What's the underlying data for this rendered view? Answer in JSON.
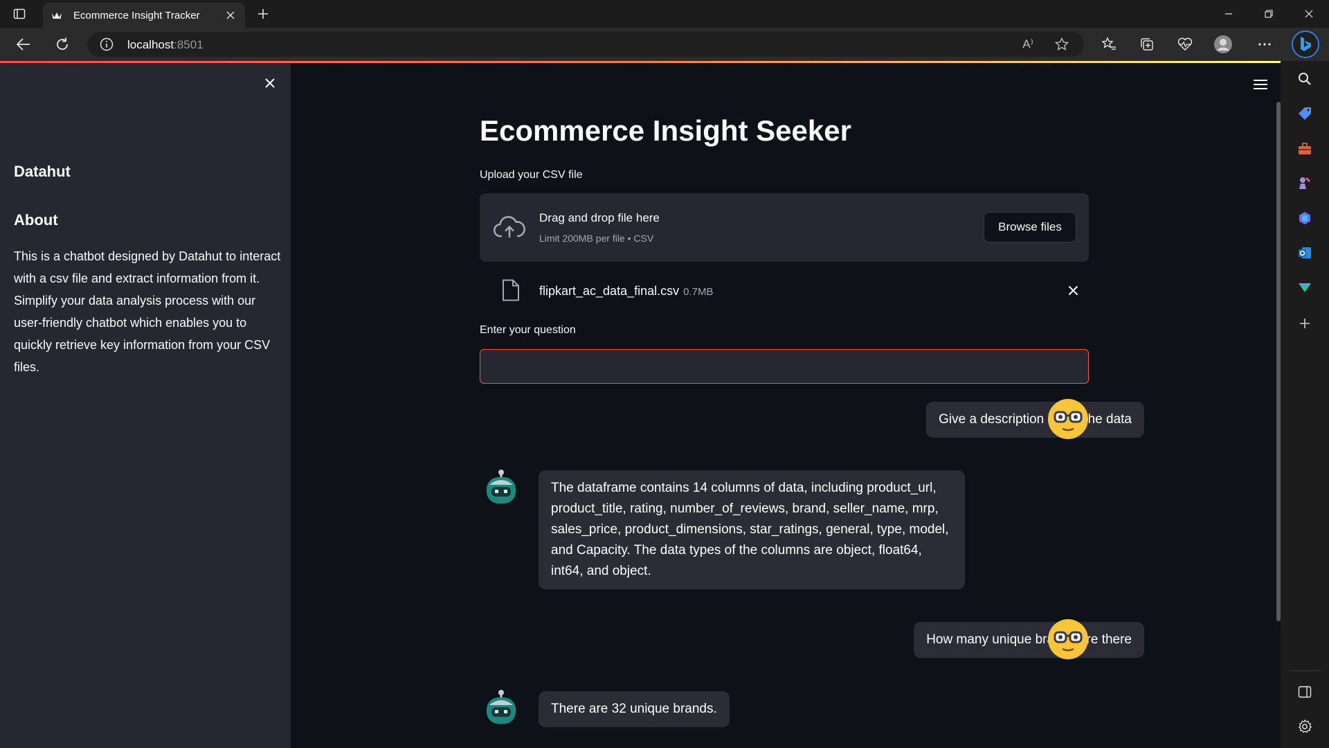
{
  "browser": {
    "tab_title": "Ecommerce Insight Tracker",
    "address_host": "localhost",
    "address_port": ":8501",
    "read_aloud_label": "A⁾"
  },
  "sidebar": {
    "title": "Datahut",
    "about_heading": "About",
    "about_text": "This is a chatbot designed by Datahut to interact with a csv file and extract information from it. Simplify your data analysis process with our user-friendly chatbot which enables you to quickly retrieve key information from your CSV files."
  },
  "main": {
    "title": "Ecommerce Insight Seeker",
    "upload": {
      "label": "Upload your CSV file",
      "drop_text": "Drag and drop file here",
      "limit_text": "Limit 200MB per file • CSV",
      "browse_label": "Browse files"
    },
    "file": {
      "name": "flipkart_ac_data_final.csv",
      "size": "0.7MB"
    },
    "question": {
      "label": "Enter your question",
      "value": ""
    },
    "chat": [
      {
        "role": "user",
        "text": "Give a description about the data"
      },
      {
        "role": "bot",
        "text": "The dataframe contains 14 columns of data, including product_url, product_title, rating, number_of_reviews, brand, seller_name, mrp, sales_price, product_dimensions, star_ratings, general, type, model, and Capacity. The data types of the columns are object, float64, int64, and object."
      },
      {
        "role": "user",
        "text": "How many unique brands are there"
      },
      {
        "role": "bot",
        "text": "There are 32 unique brands."
      }
    ]
  },
  "colors": {
    "accent": "#ff4b4b",
    "app_bg": "#0e1117",
    "sidebar_bg": "#262730",
    "bubble_bg": "#2b2c36",
    "user_avatar": "#f7c638",
    "bot_avatar": "#1a8a7f"
  },
  "icons": {
    "tab_actions": "tab-actions-icon",
    "favicon": "streamlit-crown-icon",
    "back": "back-arrow-icon",
    "refresh": "refresh-icon",
    "info": "info-icon",
    "read_aloud": "read-aloud-icon",
    "favorite": "star-icon",
    "favorites": "favorites-icon",
    "collections": "collections-icon",
    "browser_essentials": "heart-pulse-icon",
    "profile": "profile-icon",
    "more": "more-icon",
    "bing": "bing-icon",
    "upload": "cloud-upload-icon",
    "file": "file-icon",
    "menu": "hamburger-icon"
  }
}
